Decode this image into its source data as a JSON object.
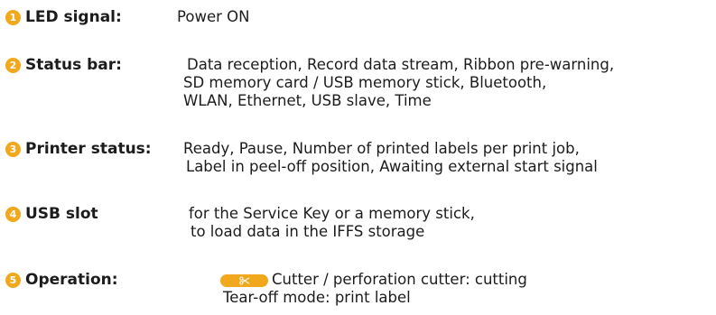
{
  "badge_color": "#f2a81d",
  "items": [
    {
      "number": "1",
      "label": "LED signal:",
      "lines": [
        "Power ON"
      ]
    },
    {
      "number": "2",
      "label": "Status bar:",
      "lines": [
        "Data reception, Record data stream, Ribbon pre-warning,",
        "SD memory card / USB memory stick, Bluetooth,",
        "WLAN, Ethernet, USB slave, Time"
      ]
    },
    {
      "number": "3",
      "label": "Printer status:",
      "lines": [
        "Ready, Pause, Number of printed labels per print job,",
        "Label in peel-off position, Awaiting external start signal"
      ]
    },
    {
      "number": "4",
      "label": "USB slot",
      "lines": [
        "for the Service Key or a memory stick,",
        "to load data in the IFFS storage"
      ]
    },
    {
      "number": "5",
      "label": "Operation:",
      "key_icon": "scissors-icon",
      "lines": [
        "Cutter / perforation cutter: cutting",
        "Tear-off mode: print label"
      ]
    }
  ]
}
